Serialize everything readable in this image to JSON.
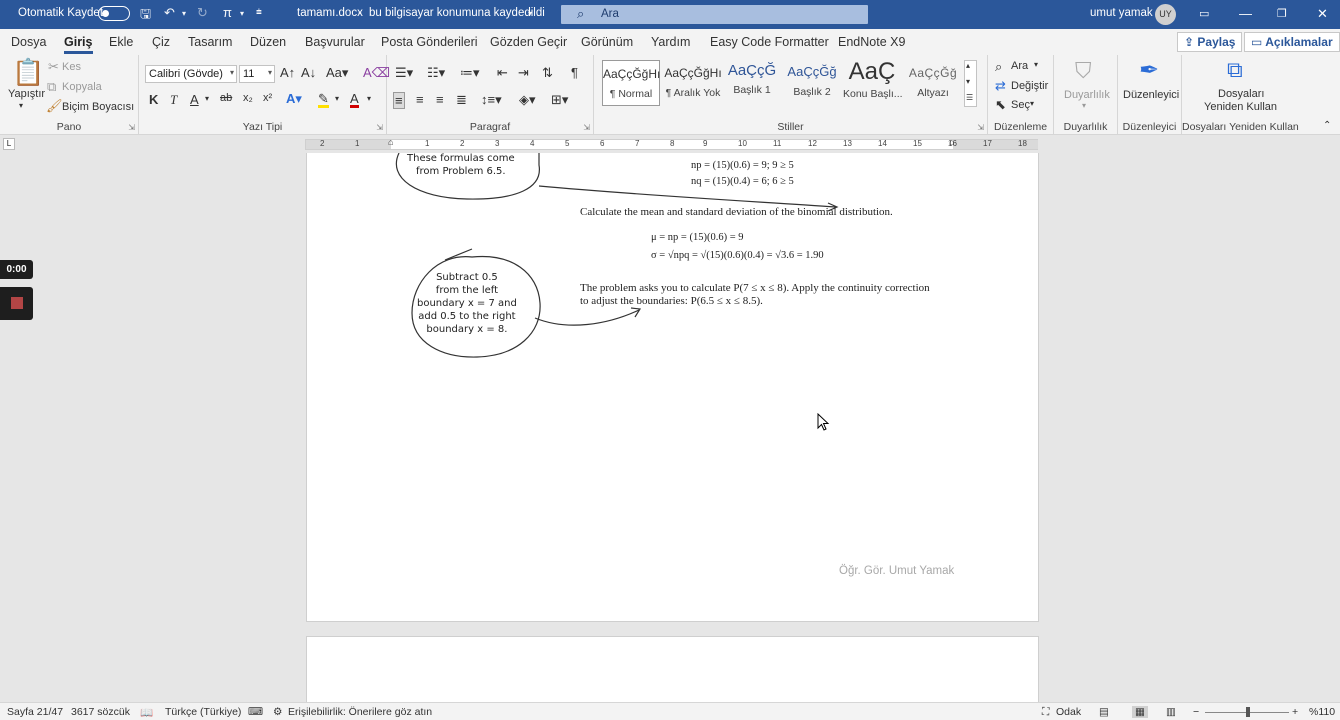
{
  "titlebar": {
    "autosave_label": "Otomatik Kaydet",
    "doc_name": "tamamı.docx",
    "separator": "-",
    "save_status": "bu bilgisayar konumuna kaydedildi",
    "search_placeholder": "Ara",
    "user_name": "umut yamak",
    "user_initials": "UY"
  },
  "menu": {
    "tabs": [
      "Dosya",
      "Giriş",
      "Ekle",
      "Çiz",
      "Tasarım",
      "Düzen",
      "Başvurular",
      "Posta Gönderileri",
      "Gözden Geçir",
      "Görünüm",
      "Yardım",
      "Easy Code Formatter",
      "EndNote X9"
    ],
    "active_tab": "Giriş",
    "share_label": "Paylaş",
    "comments_label": "Açıklamalar"
  },
  "ribbon": {
    "clipboard": {
      "paste": "Yapıştır",
      "cut": "Kes",
      "copy": "Kopyala",
      "format_painter": "Biçim Boyacısı",
      "label": "Pano"
    },
    "font": {
      "family": "Calibri (Gövde)",
      "size": "11",
      "bold": "K",
      "italic": "T",
      "underline": "A",
      "label": "Yazı Tipi"
    },
    "paragraph": {
      "label": "Paragraf"
    },
    "styles": {
      "items": [
        {
          "preview": "AaÇçĞğHı",
          "name": "¶ Normal"
        },
        {
          "preview": "AaÇçĞğHı",
          "name": "¶ Aralık Yok"
        },
        {
          "preview": "AaÇçĞ",
          "name": "Başlık 1"
        },
        {
          "preview": "AaÇçĞğ",
          "name": "Başlık 2"
        },
        {
          "preview": "AaÇ",
          "name": "Konu Başlı..."
        },
        {
          "preview": "AaÇçĞğ",
          "name": "Altyazı"
        }
      ],
      "label": "Stiller"
    },
    "editing": {
      "find": "Ara",
      "replace": "Değiştir",
      "select": "Seç",
      "label": "Düzenleme"
    },
    "sensitivity": {
      "button": "Duyarlılık",
      "label": "Duyarlılık"
    },
    "editor": {
      "button": "Düzenleyici",
      "label": "Düzenleyici"
    },
    "reuse": {
      "button_line1": "Dosyaları",
      "button_line2": "Yeniden Kullan",
      "label": "Dosyaları Yeniden Kullan"
    }
  },
  "ruler": {
    "ticks": [
      "2",
      "1",
      "1",
      "2",
      "3",
      "4",
      "5",
      "6",
      "7",
      "8",
      "9",
      "10",
      "11",
      "12",
      "13",
      "14",
      "15",
      "16",
      "17",
      "18"
    ]
  },
  "document": {
    "bubble1": [
      "These formulas come",
      "from Problem 6.5."
    ],
    "np_line": "np = (15)(0.6) = 9; 9 ≥ 5",
    "nq_line": "nq = (15)(0.4) = 6; 6 ≥ 5",
    "instruction": "Calculate the mean and standard deviation of the binomial distribution.",
    "mu_line": "μ = np = (15)(0.6) = 9",
    "sigma_line": "σ = √npq = √(15)(0.6)(0.4) = √3.6 = 1.90",
    "bubble2": [
      "Subtract 0.5",
      "from the left",
      "boundary x = 7 and",
      "add 0.5 to the right",
      "boundary x = 8."
    ],
    "problem_line1": "The problem asks you to calculate P(7 ≤ x ≤ 8). Apply the continuity correction",
    "problem_line2": "to adjust the boundaries: P(6.5 ≤ x ≤ 8.5).",
    "watermark": "Öğr. Gör. Umut Yamak"
  },
  "recorder": {
    "time": "0:00"
  },
  "status": {
    "page": "Sayfa 21/47",
    "words": "3617 sözcük",
    "language": "Türkçe (Türkiye)",
    "accessibility": "Erişilebilirlik: Önerilere göz atın",
    "focus": "Odak",
    "zoom": "%110"
  },
  "colors": {
    "titlebar": "#2b579a",
    "accent": "#2b579a",
    "ribbon_bg": "#f3f3f3",
    "canvas_bg": "#e6e6e6",
    "record": "#b24545"
  }
}
